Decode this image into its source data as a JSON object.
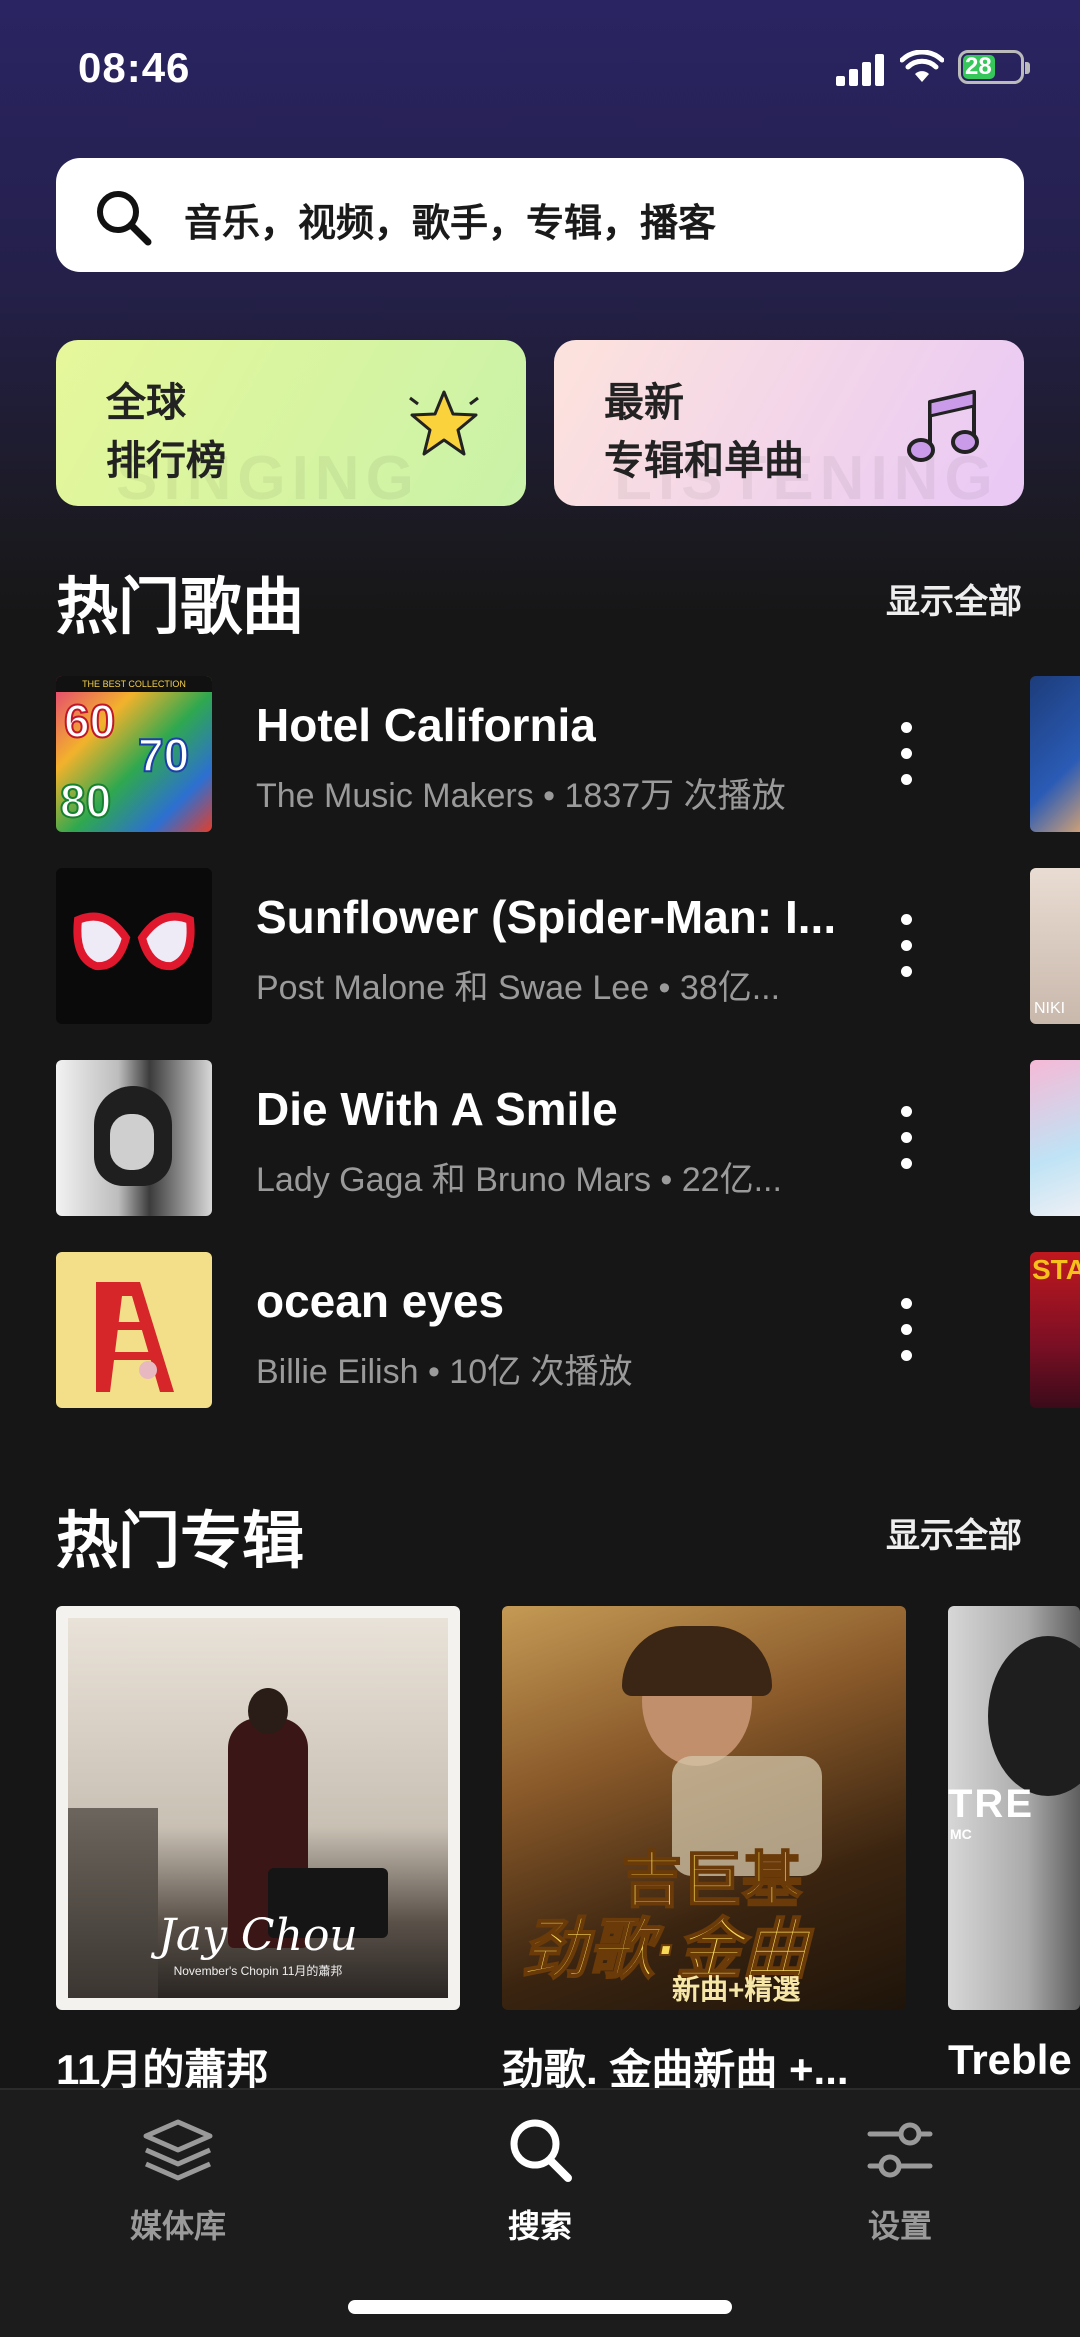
{
  "status_bar": {
    "time": "08:46",
    "battery": "28"
  },
  "search": {
    "placeholder": "音乐，视频，歌手，专辑，播客"
  },
  "cards": {
    "rank": {
      "line1": "全球",
      "line2": "排行榜",
      "watermark": "SINGING"
    },
    "new": {
      "line1": "最新",
      "line2": "专辑和单曲",
      "watermark": "LISTENING"
    }
  },
  "hot_songs": {
    "title": "热门歌曲",
    "show_all": "显示全部",
    "items": [
      {
        "title": "Hotel California",
        "subtitle": "The Music Makers • 1837万 次播放"
      },
      {
        "title": "Sunflower (Spider-Man: I...",
        "subtitle": "Post Malone 和 Swae Lee • 38亿..."
      },
      {
        "title": "Die With A Smile",
        "subtitle": "Lady Gaga 和 Bruno Mars • 22亿..."
      },
      {
        "title": "ocean eyes",
        "subtitle": "Billie Eilish • 10亿 次播放"
      }
    ],
    "peek_labels": {
      "niki": "NIKI",
      "sta": "STA"
    }
  },
  "cover_texts": {
    "best_collection": "THE BEST COLLECTION",
    "sixties": "60",
    "seventies": "70",
    "eighties": "80",
    "jay_chou": "Jay Chou",
    "nov_chopin": "November's Chopin 11月的蕭邦",
    "gold_title": "吉巨基",
    "gold_sub": "劲歌·金曲",
    "gold_tag": "新曲+精選",
    "treble": "TRE",
    "treble_mc": "MC"
  },
  "hot_albums": {
    "title": "热门专辑",
    "show_all": "显示全部",
    "items": [
      {
        "name": "11月的蕭邦"
      },
      {
        "name": "劲歌. 金曲新曲 +..."
      },
      {
        "name": "Treble"
      }
    ]
  },
  "tabs": [
    {
      "label": "媒体库",
      "icon": "layers-icon"
    },
    {
      "label": "搜索",
      "icon": "search-icon"
    },
    {
      "label": "设置",
      "icon": "sliders-icon"
    }
  ],
  "colors": {
    "background": "#161616",
    "subtitle": "#9a9a9a",
    "inactive_tab": "#9a9a9a"
  }
}
